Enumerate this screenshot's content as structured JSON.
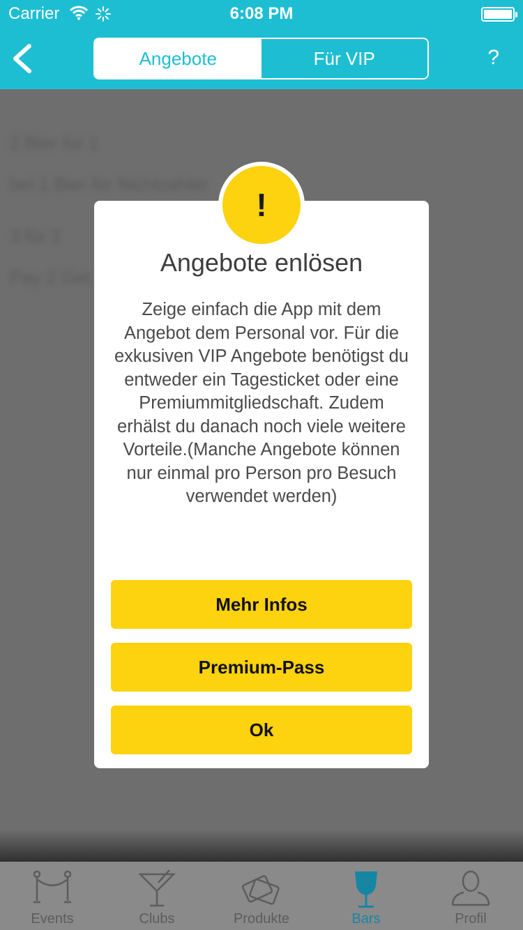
{
  "status_bar": {
    "carrier": "Carrier",
    "time": "6:08 PM"
  },
  "nav": {
    "segments": [
      "Angebote",
      "Für VIP"
    ],
    "selected_segment": "Angebote",
    "help_label": "?",
    "accent_color": "#1ebed2"
  },
  "background_list": [
    "2 Bier für 1",
    "bei 1 Bier für Nichtzahler",
    "3 für 2",
    "Pay 2 Get 3"
  ],
  "modal": {
    "icon_label": "!",
    "title": "Angebote enlösen",
    "body": "Zeige einfach die App mit dem Angebot dem Personal vor. Für die exkusiven VIP Angebote benötigst du entweder ein Tagesticket oder eine Premiummitgliedschaft. Zudem erhälst du danach noch viele weitere Vorteile.(Manche Angebote können nur einmal pro Person pro Besuch verwendet werden)",
    "buttons": [
      "Mehr Infos",
      "Premium-Pass",
      "Ok"
    ],
    "button_color": "#fdd20e"
  },
  "tabbar": {
    "tabs": [
      {
        "label": "Events",
        "icon": "rope-barrier-icon"
      },
      {
        "label": "Clubs",
        "icon": "cocktail-glass-icon"
      },
      {
        "label": "Produkte",
        "icon": "tickets-icon"
      },
      {
        "label": "Bars",
        "icon": "wine-glass-icon"
      },
      {
        "label": "Profil",
        "icon": "person-icon"
      }
    ],
    "selected": "Bars"
  }
}
